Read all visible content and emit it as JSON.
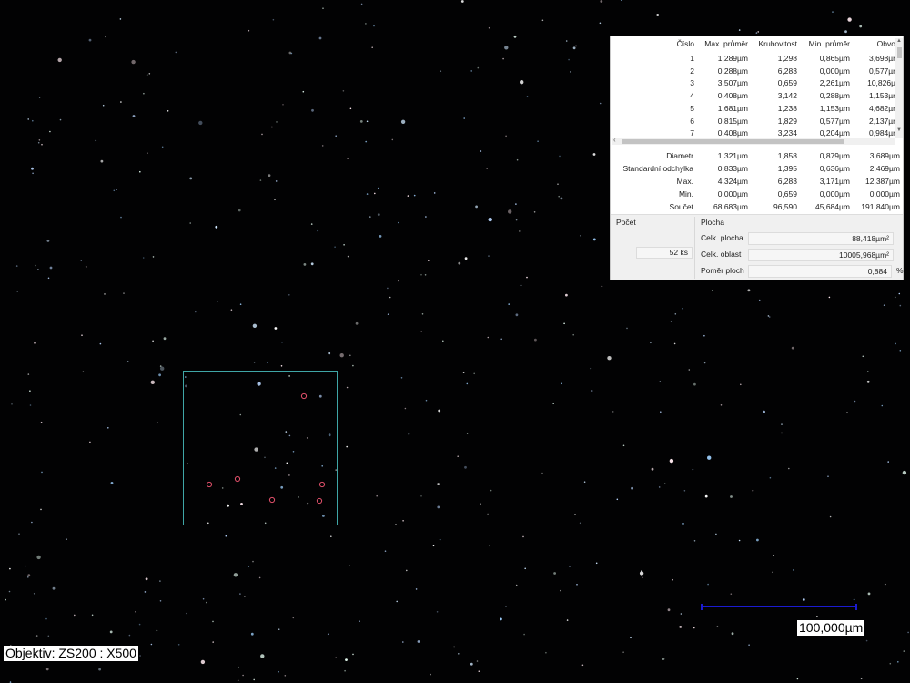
{
  "measurement_table": {
    "columns": [
      "Číslo",
      "Max. průměr",
      "Kruhovitost",
      "Min. průměr",
      "Obvo"
    ],
    "rows": [
      [
        "1",
        "1,289µm",
        "1,298",
        "0,865µm",
        "3,698µr"
      ],
      [
        "2",
        "0,288µm",
        "6,283",
        "0,000µm",
        "0,577µr"
      ],
      [
        "3",
        "3,507µm",
        "0,659",
        "2,261µm",
        "10,826µ"
      ],
      [
        "4",
        "0,408µm",
        "3,142",
        "0,288µm",
        "1,153µr"
      ],
      [
        "5",
        "1,681µm",
        "1,238",
        "1,153µm",
        "4,682µr"
      ],
      [
        "6",
        "0,815µm",
        "1,829",
        "0,577µm",
        "2,137µr"
      ],
      [
        "7",
        "0,408µm",
        "3,234",
        "0,204µm",
        "0,984µr"
      ]
    ]
  },
  "statistics": {
    "rows": [
      [
        "Diametr",
        "1,321µm",
        "1,858",
        "0,879µm",
        "3,689µm"
      ],
      [
        "Standardní odchylka",
        "0,833µm",
        "1,395",
        "0,636µm",
        "2,469µm"
      ],
      [
        "Max.",
        "4,324µm",
        "6,283",
        "3,171µm",
        "12,387µm"
      ],
      [
        "Min.",
        "0,000µm",
        "0,659",
        "0,000µm",
        "0,000µm"
      ],
      [
        "Součet",
        "68,683µm",
        "96,590",
        "45,684µm",
        "191,840µm"
      ]
    ]
  },
  "count": {
    "title": "Počet",
    "value": "52",
    "unit": "ks"
  },
  "area": {
    "title": "Plocha",
    "total_area_label": "Celk. plocha",
    "total_area_value": "88,418µm²",
    "total_region_label": "Celk. oblast",
    "total_region_value": "10005,968µm²",
    "ratio_label": "Poměr ploch",
    "ratio_value": "0,884",
    "ratio_unit": "%"
  },
  "scale_bar": {
    "label": "100,000µm",
    "color": "#1b1bd0"
  },
  "objective": {
    "label": "Objektiv: ZS200 : X500"
  },
  "colors": {
    "roi": "#3fa6a6",
    "background": "#020203"
  }
}
